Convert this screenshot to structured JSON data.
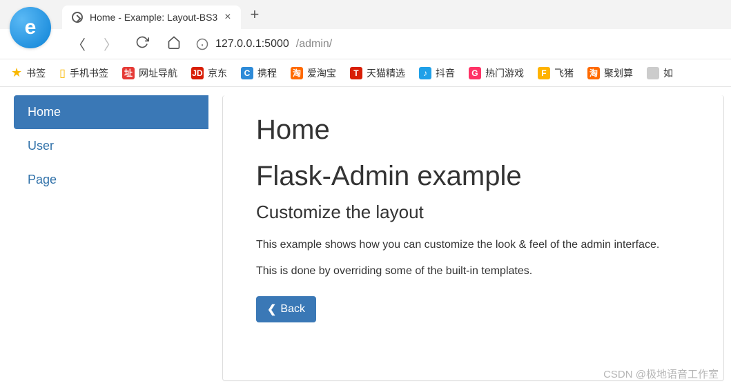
{
  "browser": {
    "tab_title": "Home - Example: Layout-BS3",
    "url_host": "127.0.0.1:5000",
    "url_path": "/admin/"
  },
  "bookmarks": [
    {
      "label": "书签",
      "icon_bg": "none",
      "icon_text": "★",
      "star": true
    },
    {
      "label": "手机书签",
      "icon_bg": "none",
      "icon_text": "📱",
      "phone": true
    },
    {
      "label": "网址导航",
      "icon_bg": "#e53935",
      "icon_text": "址"
    },
    {
      "label": "京东",
      "icon_bg": "#d81e06",
      "icon_text": "JD"
    },
    {
      "label": "携程",
      "icon_bg": "#2e8bd8",
      "icon_text": "C"
    },
    {
      "label": "爱淘宝",
      "icon_bg": "#ff6a00",
      "icon_text": "淘"
    },
    {
      "label": "天猫精选",
      "icon_bg": "#d81e06",
      "icon_text": "T"
    },
    {
      "label": "抖音",
      "icon_bg": "#1fa0e8",
      "icon_text": "♪"
    },
    {
      "label": "热门游戏",
      "icon_bg": "#ff3366",
      "icon_text": "G"
    },
    {
      "label": "飞猪",
      "icon_bg": "#ffb300",
      "icon_text": "F"
    },
    {
      "label": "聚划算",
      "icon_bg": "#ff6a00",
      "icon_text": "淘"
    },
    {
      "label": "如",
      "icon_bg": "#ccc",
      "icon_text": ""
    }
  ],
  "sidebar": {
    "items": [
      {
        "label": "Home",
        "active": true
      },
      {
        "label": "User",
        "active": false
      },
      {
        "label": "Page",
        "active": false
      }
    ]
  },
  "content": {
    "heading1": "Home",
    "heading2": "Flask-Admin example",
    "heading3": "Customize the layout",
    "para1": "This example shows how you can customize the look & feel of the admin interface.",
    "para2": "This is done by overriding some of the built-in templates.",
    "back_label": "Back"
  },
  "watermark": "CSDN @极地语音工作室"
}
